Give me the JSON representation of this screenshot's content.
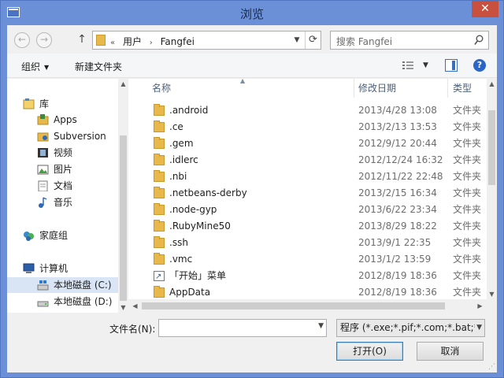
{
  "window": {
    "title": "浏览",
    "close_glyph": "✕"
  },
  "address": {
    "overflow": "«",
    "crumbs": [
      "用户",
      "Fangfei"
    ],
    "separator": "›",
    "search_placeholder": "搜索 Fangfei"
  },
  "toolbar": {
    "organize": "组织",
    "new_folder": "新建文件夹"
  },
  "nav": {
    "items": [
      {
        "label": "库",
        "icon": "library-icon",
        "indent": 0
      },
      {
        "label": "Apps",
        "icon": "apps-icon",
        "indent": 1
      },
      {
        "label": "Subversion",
        "icon": "subversion-icon",
        "indent": 1
      },
      {
        "label": "视频",
        "icon": "video-icon",
        "indent": 1
      },
      {
        "label": "图片",
        "icon": "pictures-icon",
        "indent": 1
      },
      {
        "label": "文档",
        "icon": "documents-icon",
        "indent": 1
      },
      {
        "label": "音乐",
        "icon": "music-icon",
        "indent": 1
      },
      {
        "label": "家庭组",
        "icon": "homegroup-icon",
        "indent": 0
      },
      {
        "label": "计算机",
        "icon": "computer-icon",
        "indent": 0
      },
      {
        "label": "本地磁盘 (C:)",
        "icon": "drive-c-icon",
        "indent": 1,
        "selected": true
      },
      {
        "label": "本地磁盘 (D:)",
        "icon": "drive-d-icon",
        "indent": 1
      }
    ]
  },
  "columns": {
    "name": "名称",
    "modified": "修改日期",
    "type": "类型"
  },
  "files": [
    {
      "name": ".android",
      "date": "2013/4/28 13:08",
      "type": "文件夹",
      "icon": "folder-icon"
    },
    {
      "name": ".ce",
      "date": "2013/2/13 13:53",
      "type": "文件夹",
      "icon": "folder-icon"
    },
    {
      "name": ".gem",
      "date": "2012/9/12 20:44",
      "type": "文件夹",
      "icon": "folder-icon"
    },
    {
      "name": ".idlerc",
      "date": "2012/12/24 16:32",
      "type": "文件夹",
      "icon": "folder-icon"
    },
    {
      "name": ".nbi",
      "date": "2012/11/22 22:48",
      "type": "文件夹",
      "icon": "folder-icon"
    },
    {
      "name": ".netbeans-derby",
      "date": "2013/2/15 16:34",
      "type": "文件夹",
      "icon": "folder-icon"
    },
    {
      "name": ".node-gyp",
      "date": "2013/6/22 23:34",
      "type": "文件夹",
      "icon": "folder-icon"
    },
    {
      "name": ".RubyMine50",
      "date": "2013/8/29 18:22",
      "type": "文件夹",
      "icon": "folder-icon"
    },
    {
      "name": ".ssh",
      "date": "2013/9/1 22:35",
      "type": "文件夹",
      "icon": "folder-icon"
    },
    {
      "name": ".vmc",
      "date": "2013/1/2 13:59",
      "type": "文件夹",
      "icon": "folder-icon"
    },
    {
      "name": "「开始」菜单",
      "date": "2012/8/19 18:36",
      "type": "文件夹",
      "icon": "shortcut-folder-icon"
    },
    {
      "name": "AppData",
      "date": "2012/8/19 18:36",
      "type": "文件夹",
      "icon": "folder-icon"
    }
  ],
  "bottom": {
    "filename_label": "文件名(N):",
    "filename_value": "",
    "filter": "程序 (*.exe;*.pif;*.com;*.bat;*.",
    "open": "打开(O)",
    "cancel": "取消"
  },
  "colors": {
    "frame": "#6c90d8",
    "selection": "#d9e5f5",
    "folder": "#e8b84a",
    "close": "#c7503f"
  }
}
